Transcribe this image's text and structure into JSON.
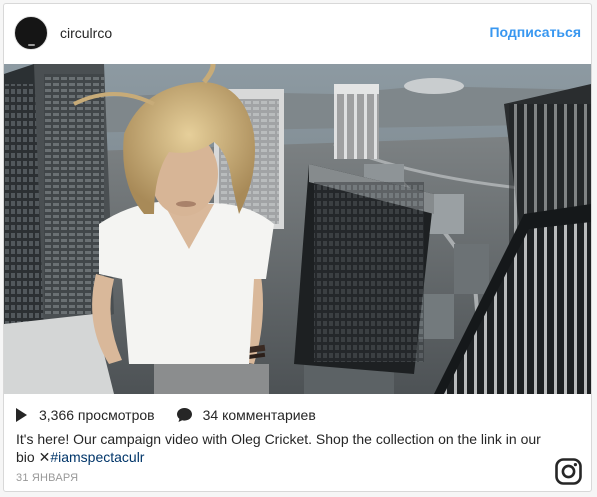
{
  "post": {
    "username": "circulrco",
    "follow_label": "Подписаться",
    "views": "3,366 просмотров",
    "comments": "34 комментариев",
    "caption_text": "It's here! Our campaign video with Oleg Cricket. Shop the collection on the link in our bio ",
    "caption_mark": "✕",
    "caption_hashtag": "#iamspectaculr",
    "date": "31 ЯНВАРЯ"
  },
  "icons": {
    "play": "play-icon",
    "comment": "comment-bubble-icon",
    "instagram": "instagram-logo-icon"
  },
  "colors": {
    "link": "#3897f0",
    "hashtag": "#003569",
    "text": "#262626",
    "muted": "#999999"
  }
}
